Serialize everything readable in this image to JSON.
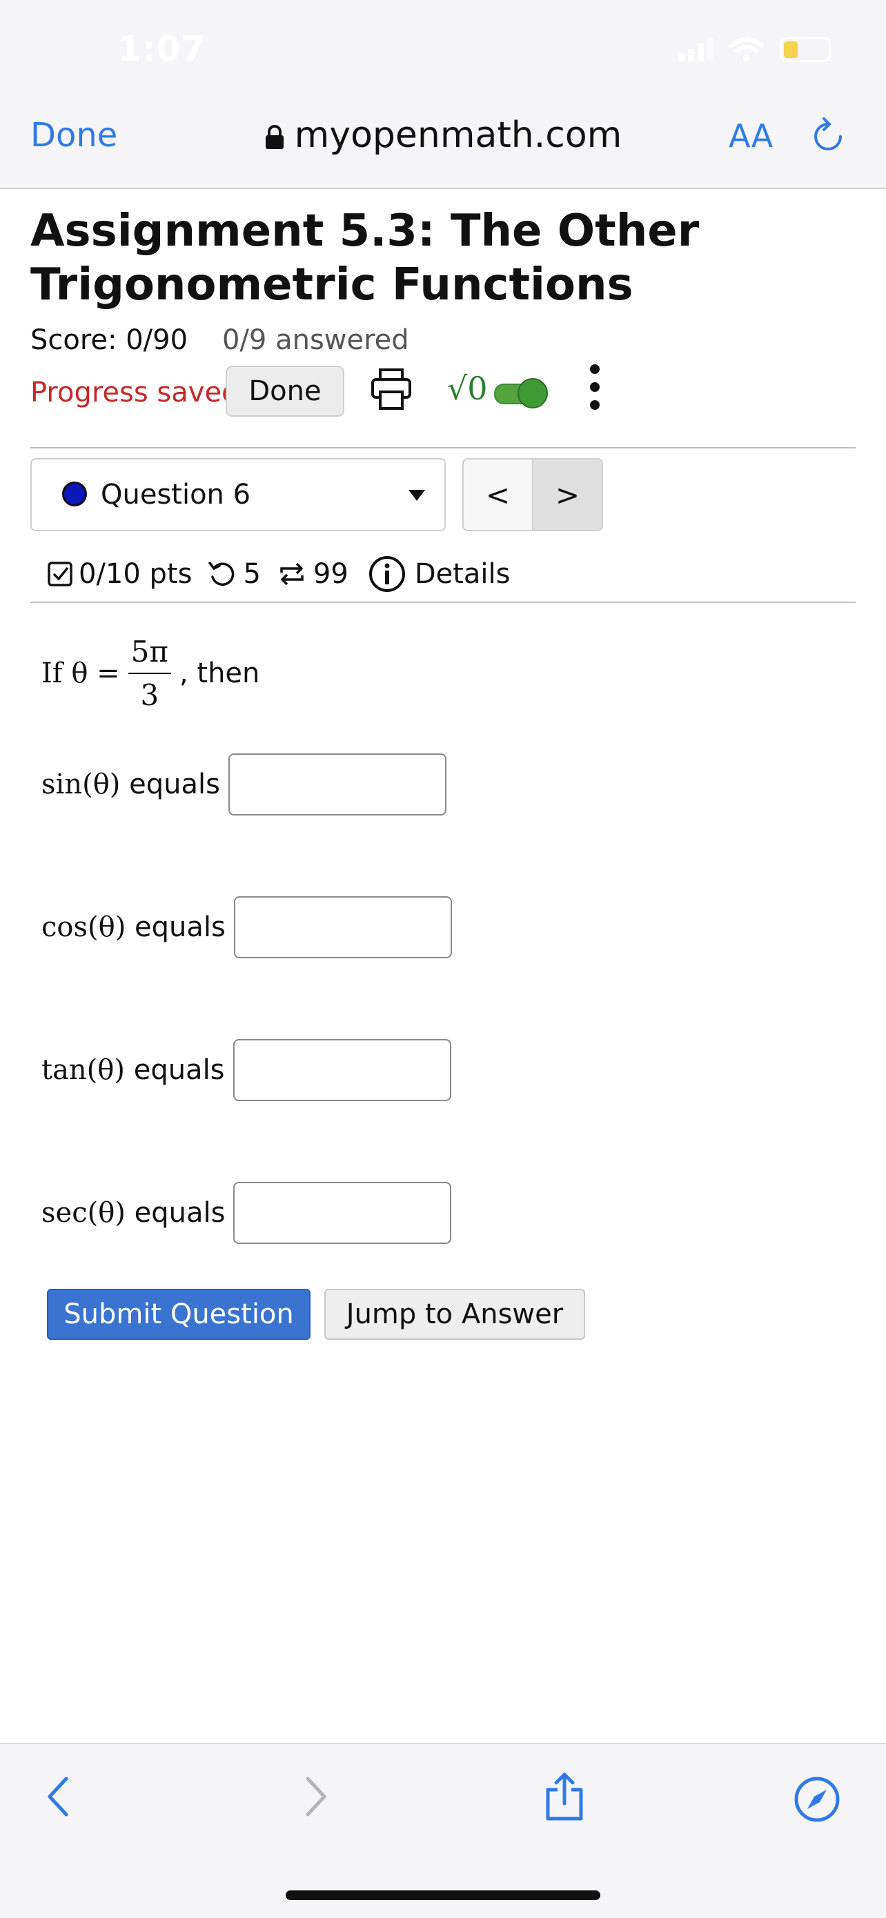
{
  "status_bar": {
    "time": "1:07"
  },
  "browser": {
    "done_label": "Done",
    "url": "myopenmath.com",
    "aa_label": "AA"
  },
  "assignment": {
    "title": "Assignment 5.3: The Other Trigonometric Functions",
    "score": "Score: 0/90",
    "answered": "0/9 answered",
    "progress": "Progress saved",
    "done_button": "Done"
  },
  "question_nav": {
    "selected": "Question 6",
    "prev": "<",
    "next": ">"
  },
  "question_meta": {
    "points": "0/10 pts",
    "retries": "5",
    "attempts": "99",
    "details": "Details"
  },
  "question": {
    "prompt_prefix": "If θ =",
    "numerator": "5π",
    "denominator": "3",
    "prompt_suffix": ", then",
    "fields": [
      {
        "label_math": "sin(θ)",
        "label_text": "equals",
        "value": ""
      },
      {
        "label_math": "cos(θ)",
        "label_text": "equals",
        "value": ""
      },
      {
        "label_math": "tan(θ)",
        "label_text": "equals",
        "value": ""
      },
      {
        "label_math": "sec(θ)",
        "label_text": "equals",
        "value": ""
      }
    ],
    "submit_label": "Submit Question",
    "jump_label": "Jump to Answer"
  },
  "colors": {
    "accent": "#2f7ae5",
    "progress": "#c62828",
    "submit": "#3a73d0",
    "toggle": "#3e9a34"
  }
}
